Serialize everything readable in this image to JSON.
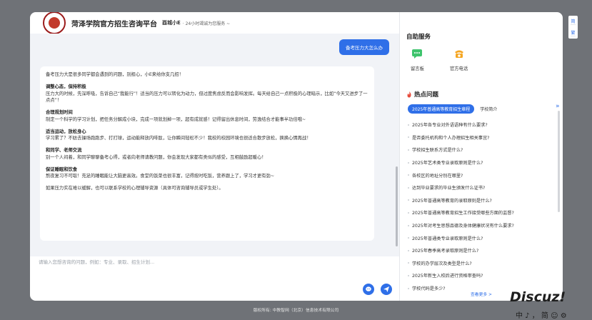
{
  "header": {
    "title": "菏泽学院官方招生咨询平台",
    "brand": "酉城小E",
    "tagline": "· 24小时竭诚为您服务 ~"
  },
  "chat": {
    "user_message": "备考压力大怎么办",
    "reply": {
      "intro": "备考压力大是很多同学都会遇到的问题，别担心，小E来给你支几招！",
      "sections": [
        {
          "title": "调整心态，保持积极",
          "body": "压力大的时候，先深呼吸，告诉自己“我能行”！适当的压力可以转化为动力，但过度焦虑反而会影响发挥。每天给自己一点积极的心理暗示，比如“今天又进步了一点点”！"
        },
        {
          "title": "合理规划时间",
          "body": "制定一个科学的学习计划，把任务分解成小块，完成一项就划掉一项，超有成就感！记得留出休息时间，劳逸结合才能事半功倍哦~"
        },
        {
          "title": "适当运动，放松身心",
          "body": "学习累了？不妨去操场跑跑步、打打球，运动能释放内啡肽，让你瞬间轻松不少！我校的校园环境也很适合散步放松，换换心情再战！"
        },
        {
          "title": "和同学、老师交流",
          "body": "别一个人闷着，和同学聊聊备考心得，或者向老师请教问题，你会发现大家都有类似的感受，互相鼓励超暖心！"
        },
        {
          "title": "保证睡眠和饮食",
          "body": "熬夜复习不可取！充足的睡眠能让大脑更高效。食堂的饭菜也很丰富，记得按时吃饭，营养跟上了，学习才更有劲~"
        }
      ],
      "closing": "如果压力实在难以缓解，也可以联系学校的心理辅导资源（具体可咨询辅导员或学生处）。"
    },
    "input_placeholder": "请输入您想咨询的问题，例如：专业、录取、招生计划..."
  },
  "sidebar": {
    "self_service_title": "自助服务",
    "tools": [
      {
        "label": "留言板"
      },
      {
        "label": "官方电话"
      }
    ],
    "hot_title": "热点问题",
    "tabs": [
      "2025年普通高等教育招生章程",
      "学校简介"
    ],
    "questions": [
      "2025年各专业对外语语种有什么要求?",
      "是否委托机构和个人办理招生相关事宜?",
      "学校招生联系方式是什么?",
      "2025年艺术类专业录取原则是什么?",
      "各校区的地址分别在哪里?",
      "达到毕业要求的毕业生颁发什么证书?",
      "2025年普通高等教育的录取原则是什么?",
      "2025年普通高等教育招生工作接受哪些方面的监督?",
      "2025年对考生思想品德及身体健康状况有什么要求?",
      "2025年普通类专业录取原则是什么?",
      "2025年春季高考录取原则是什么?",
      "学校的办学层次及类型是什么?",
      "2025年新生入校后进行资格审查吗?",
      "学校代码是多少?"
    ],
    "see_more": "查看更多 >"
  },
  "lang": {
    "simplified": "简",
    "traditional": "繁"
  },
  "footer": {
    "copyright": "版权所有: 中教智网（北京）信息技术有限公司"
  },
  "watermark": {
    "text": "Discuz!",
    "bar": "中 ♪ ， 简 ☺ ⚙"
  },
  "colors": {
    "accent": "#2f6fe8",
    "hot": "#e74c3c"
  }
}
